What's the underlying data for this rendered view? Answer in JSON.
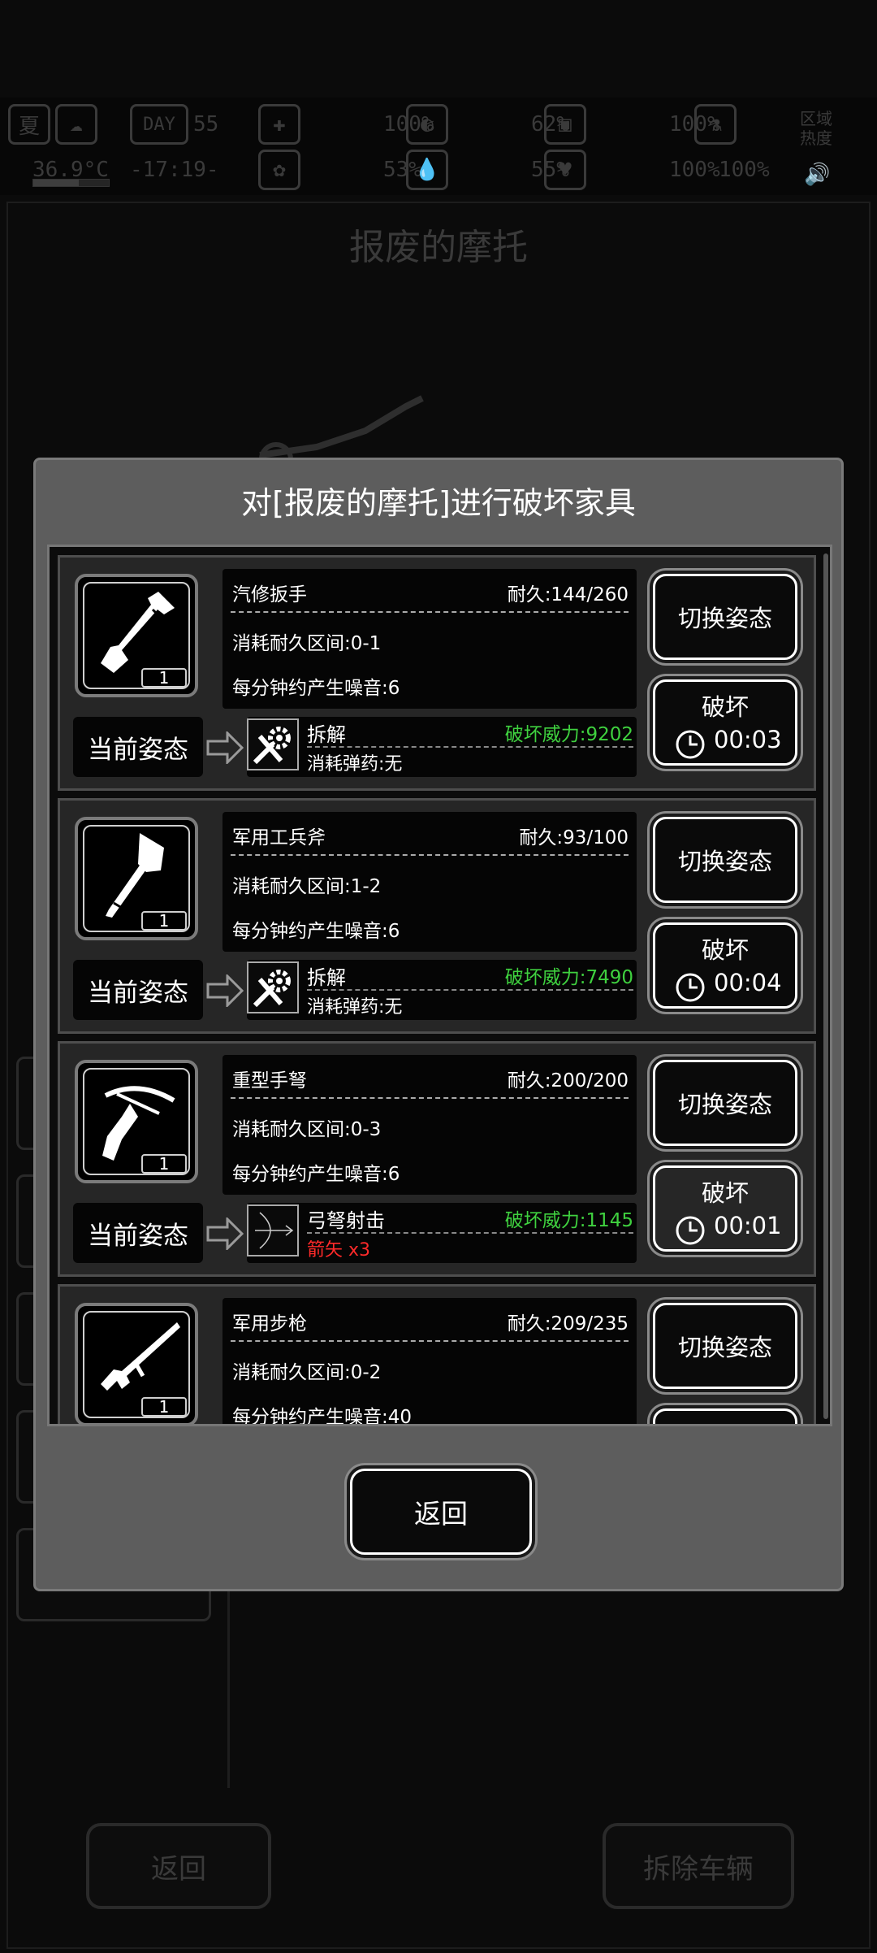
{
  "status_bar": {
    "season": "夏",
    "day_label": "DAY",
    "day_number": "55",
    "body_temp": "36.9°C",
    "clock": "-17:19-",
    "stats": [
      {
        "key": "health",
        "value": "100%"
      },
      {
        "key": "stomach",
        "value": "62%"
      },
      {
        "key": "stamina",
        "value": "100%"
      },
      {
        "key": "mental",
        "value": "53%"
      },
      {
        "key": "water",
        "value": "55%"
      },
      {
        "key": "heart",
        "value": "100%"
      },
      {
        "key": "toxicity",
        "value": "100%"
      }
    ],
    "area_heat_label": "区域热度"
  },
  "background": {
    "title": "报废的摩托",
    "return_label": "返回",
    "dismantle_label": "拆除车辆"
  },
  "modal": {
    "title": "对[报废的摩托]进行破坏家具",
    "current_stance_label": "当前姿态",
    "switch_stance_label": "切换姿态",
    "break_label": "破坏",
    "return_label": "返回",
    "items": [
      {
        "name": "汽修扳手",
        "durability": "耐久:144/260",
        "range": "消耗耐久区间:0-1",
        "noise": "每分钟约产生噪音:6",
        "quantity": "1",
        "icon": "wrench-icon",
        "stance": "拆解",
        "stance_icon": "gear-wrench-icon",
        "power": "破坏威力:9202",
        "ammo": "消耗弹药:无",
        "ammo_color": "#ffffff",
        "time": "00:03"
      },
      {
        "name": "军用工兵斧",
        "durability": "耐久:93/100",
        "range": "消耗耐久区间:1-2",
        "noise": "每分钟约产生噪音:6",
        "quantity": "1",
        "icon": "axe-icon",
        "stance": "拆解",
        "stance_icon": "gear-wrench-icon",
        "power": "破坏威力:7490",
        "ammo": "消耗弹药:无",
        "ammo_color": "#ffffff",
        "time": "00:04"
      },
      {
        "name": "重型手弩",
        "durability": "耐久:200/200",
        "range": "消耗耐久区间:0-3",
        "noise": "每分钟约产生噪音:6",
        "quantity": "1",
        "icon": "crossbow-icon",
        "stance": "弓弩射击",
        "stance_icon": "arrow-shot-icon",
        "power": "破坏威力:1145",
        "ammo": "箭矢 x3",
        "ammo_color": "#ff2a2a",
        "time": "00:01"
      },
      {
        "name": "军用步枪",
        "durability": "耐久:209/235",
        "range": "消耗耐久区间:0-2",
        "noise": "每分钟约产生噪音:40",
        "quantity": "1",
        "icon": "rifle-icon"
      }
    ]
  }
}
